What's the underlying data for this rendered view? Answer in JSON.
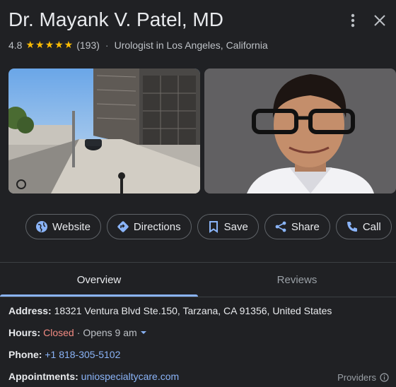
{
  "header": {
    "title": "Dr. Mayank V. Patel, MD",
    "rating": "4.8",
    "stars": "★★★★★",
    "review_count": "(193)",
    "separator": "·",
    "category": "Urologist in Los Angeles, California"
  },
  "icons": {
    "more": "more-vert-icon",
    "close": "close-icon",
    "website": "globe-icon",
    "directions": "directions-icon",
    "save": "bookmark-icon",
    "share": "share-icon",
    "call": "phone-icon",
    "info": "info-icon"
  },
  "actions": {
    "website": "Website",
    "directions": "Directions",
    "save": "Save",
    "share": "Share",
    "call": "Call"
  },
  "tabs": {
    "overview": "Overview",
    "reviews": "Reviews"
  },
  "details": {
    "address_label": "Address:",
    "address_value": "18321 Ventura Blvd Ste.150, Tarzana, CA 91356, United States",
    "hours_label": "Hours:",
    "hours_status": "Closed",
    "hours_sep": "·",
    "hours_opens": "Opens 9 am",
    "phone_label": "Phone:",
    "phone_value": "+1 818-305-5102",
    "appointments_label": "Appointments:",
    "appointments_value": "uniospecialtycare.com",
    "providers": "Providers"
  },
  "colors": {
    "background": "#202124",
    "accent": "#8ab4f8",
    "star": "#fbbc04",
    "closed": "#f28b82"
  }
}
